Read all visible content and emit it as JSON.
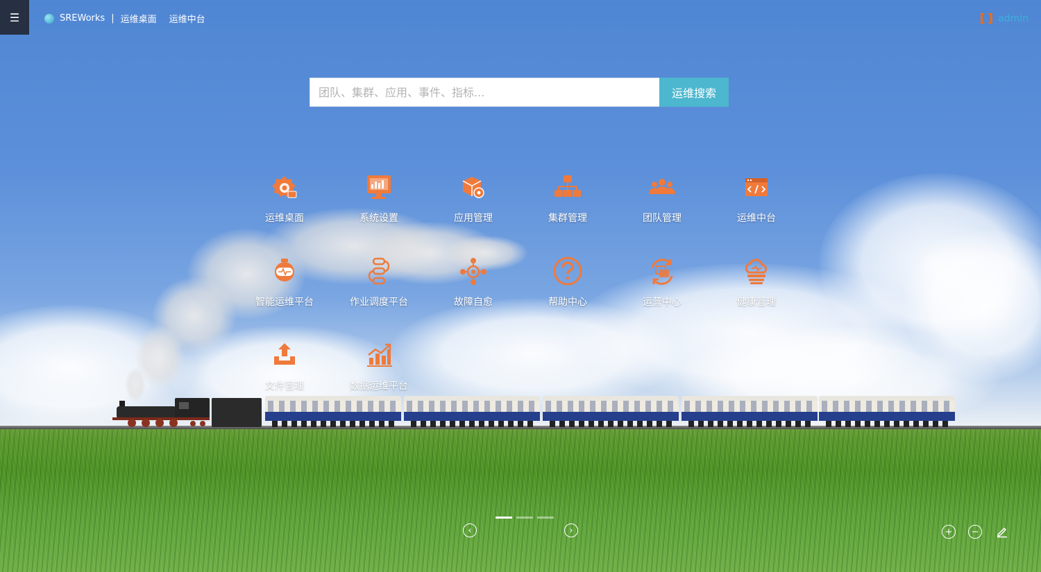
{
  "header": {
    "menu_icon": "hamburger-icon",
    "brand_name": "SREWorks",
    "separator": "|",
    "current_app": "运维桌面",
    "nav_link": "运维中台",
    "user_logo": "[ ]",
    "user_name": "admin"
  },
  "search": {
    "placeholder": "团队、集群、应用、事件、指标...",
    "button_label": "运维搜索"
  },
  "apps": [
    {
      "label": "运维桌面",
      "icon": "gear-desktop-icon"
    },
    {
      "label": "系统设置",
      "icon": "monitor-settings-icon"
    },
    {
      "label": "应用管理",
      "icon": "app-box-icon"
    },
    {
      "label": "集群管理",
      "icon": "cluster-tree-icon"
    },
    {
      "label": "团队管理",
      "icon": "team-icon"
    },
    {
      "label": "运维中台",
      "icon": "code-panel-icon"
    },
    {
      "label": "智能运维平台",
      "icon": "robot-icon"
    },
    {
      "label": "作业调度平台",
      "icon": "schedule-flow-icon"
    },
    {
      "label": "故障自愈",
      "icon": "self-heal-icon"
    },
    {
      "label": "帮助中心",
      "icon": "help-icon"
    },
    {
      "label": "运营中心",
      "icon": "operations-icon"
    },
    {
      "label": "健康管理",
      "icon": "health-cloud-icon"
    },
    {
      "label": "文件管理",
      "icon": "file-upload-icon"
    },
    {
      "label": "数据运维平台",
      "icon": "data-chart-icon"
    }
  ],
  "pager": {
    "prev_icon": "chevron-left-icon",
    "next_icon": "chevron-right-icon",
    "page_count": 3,
    "current_page": 1
  },
  "tools": {
    "zoom_in_icon": "zoom-in-icon",
    "zoom_out_icon": "zoom-out-icon",
    "edit_icon": "edit-icon"
  },
  "colors": {
    "accent": "#4cb7cf",
    "icon_orange": "#ef7a3c",
    "menu_bg": "#263042",
    "brand_orange": "#ff6a00"
  }
}
